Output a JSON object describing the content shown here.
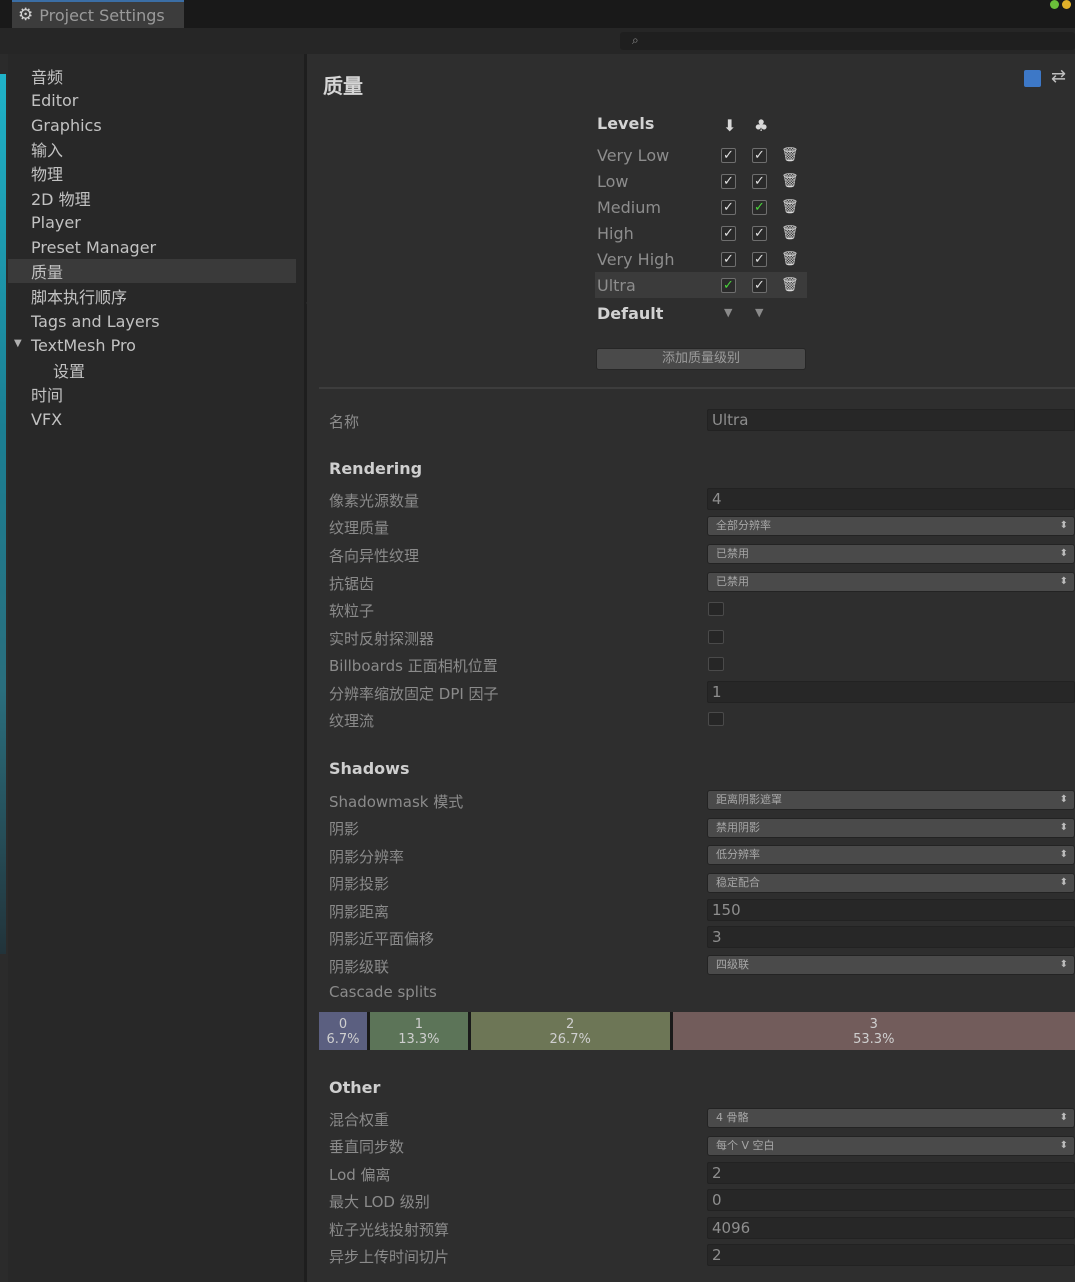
{
  "window": {
    "tab_title": "Project Settings"
  },
  "sidebar": {
    "items": [
      {
        "label": "音频"
      },
      {
        "label": "Editor"
      },
      {
        "label": "Graphics"
      },
      {
        "label": "输入"
      },
      {
        "label": "物理"
      },
      {
        "label": "2D 物理"
      },
      {
        "label": "Player"
      },
      {
        "label": "Preset Manager"
      },
      {
        "label": "质量"
      },
      {
        "label": "脚本执行顺序"
      },
      {
        "label": "Tags and Layers"
      },
      {
        "label": "TextMesh Pro"
      },
      {
        "label": "设置"
      },
      {
        "label": "时间"
      },
      {
        "label": "VFX"
      }
    ],
    "selected": "质量"
  },
  "main": {
    "title": "质量",
    "levels": {
      "header": "Levels",
      "rows": [
        {
          "name": "Very Low",
          "pc": "✓",
          "mobile": "✓"
        },
        {
          "name": "Low",
          "pc": "✓",
          "mobile": "✓"
        },
        {
          "name": "Medium",
          "pc": "✓",
          "mobile": "✓"
        },
        {
          "name": "High",
          "pc": "✓",
          "mobile": "✓"
        },
        {
          "name": "Very High",
          "pc": "✓",
          "mobile": "✓"
        },
        {
          "name": "Ultra",
          "pc": "✓",
          "mobile": "✓"
        }
      ],
      "green_default_pc": "Ultra",
      "green_default_mobile": "Medium",
      "default_label": "Default",
      "add_button": "添加质量级别"
    },
    "name_label": "名称",
    "name_value": "Ultra",
    "rendering": {
      "header": "Rendering",
      "pixel_light_label": "像素光源数量",
      "pixel_light_value": "4",
      "texture_quality_label": "纹理质量",
      "texture_quality_value": "全部分辨率",
      "anisotropic_label": "各向异性纹理",
      "anisotropic_value": "已禁用",
      "antialias_label": "抗锯齿",
      "antialias_value": "已禁用",
      "soft_particles_label": "软粒子",
      "realtime_probes_label": "实时反射探测器",
      "billboards_label": "Billboards 正面相机位置",
      "dpi_label": "分辨率缩放固定 DPI 因子",
      "dpi_value": "1",
      "texture_streaming_label": "纹理流"
    },
    "shadows": {
      "header": "Shadows",
      "shadowmask_label": "Shadowmask 模式",
      "shadowmask_value": "距离阴影遮罩",
      "shadows_label": "阴影",
      "shadows_value": "禁用阴影",
      "resolution_label": "阴影分辨率",
      "resolution_value": "低分辨率",
      "projection_label": "阴影投影",
      "projection_value": "稳定配合",
      "distance_label": "阴影距离",
      "distance_value": "150",
      "near_plane_label": "阴影近平面偏移",
      "near_plane_value": "3",
      "cascades_label": "阴影级联",
      "cascades_value": "四级联",
      "cascade_splits_label": "Cascade splits",
      "splits": [
        {
          "index": "0",
          "percent": "6.7%",
          "fraction": 0.067,
          "color": "#5b5f80"
        },
        {
          "index": "1",
          "percent": "13.3%",
          "fraction": 0.133,
          "color": "#5c7458"
        },
        {
          "index": "2",
          "percent": "26.7%",
          "fraction": 0.267,
          "color": "#6d7656"
        },
        {
          "index": "3",
          "percent": "53.3%",
          "fraction": 0.533,
          "color": "#725c5b"
        }
      ]
    },
    "other": {
      "header": "Other",
      "blend_weights_label": "混合权重",
      "blend_weights_value": "4 骨骼",
      "vsync_label": "垂直同步数",
      "vsync_value": "每个 V 空白",
      "lod_bias_label": "Lod 偏离",
      "lod_bias_value": "2",
      "max_lod_label": "最大 LOD 级别",
      "max_lod_value": "0",
      "raycast_label": "粒子光线投射预算",
      "raycast_value": "4096",
      "async_label": "异步上传时间切片",
      "async_value": "2"
    }
  },
  "colors": {
    "accent_tab": "#3b6ea5",
    "check_green": "#4ad43b",
    "book_blue": "#3d78c7"
  }
}
